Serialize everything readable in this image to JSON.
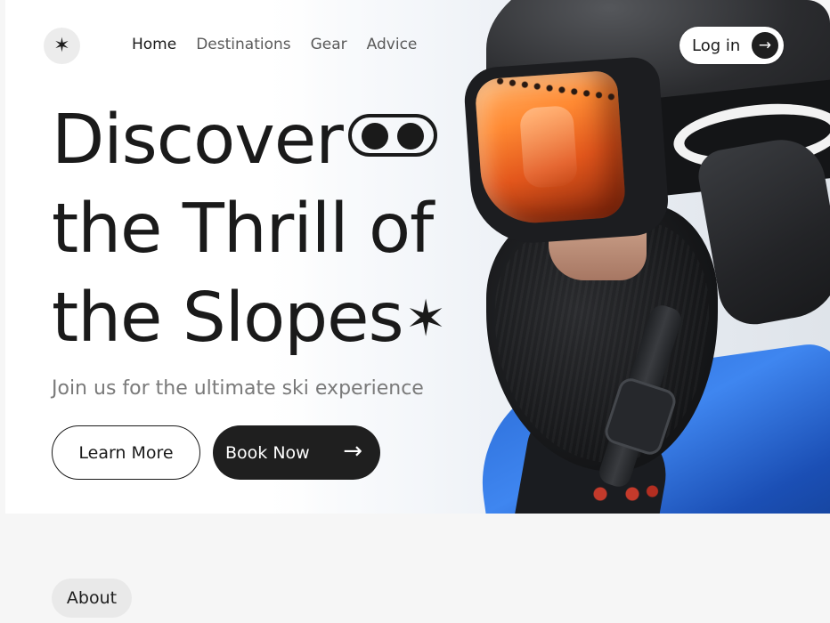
{
  "nav": {
    "brand_icon": "✶",
    "items": [
      {
        "label": "Home",
        "active": true
      },
      {
        "label": "Destinations",
        "active": false
      },
      {
        "label": "Gear",
        "active": false
      },
      {
        "label": "Advice",
        "active": false
      }
    ],
    "login_label": "Log in",
    "login_icon": "→"
  },
  "hero": {
    "headline_line1": "Discover",
    "headline_line2": "the Thrill of",
    "headline_line3": "the Slopes",
    "headline_star": "✶",
    "subtitle": "Join us for the ultimate ski experience",
    "learn_more_label": "Learn More",
    "book_now_label": "Book Now",
    "book_now_icon": "→"
  },
  "about": {
    "label": "About"
  },
  "colors": {
    "primary_dark": "#1f1f1f",
    "text_muted": "#7a7a7a",
    "lens_orange": "#ff8a33",
    "jacket_blue": "#2c6ed9"
  }
}
